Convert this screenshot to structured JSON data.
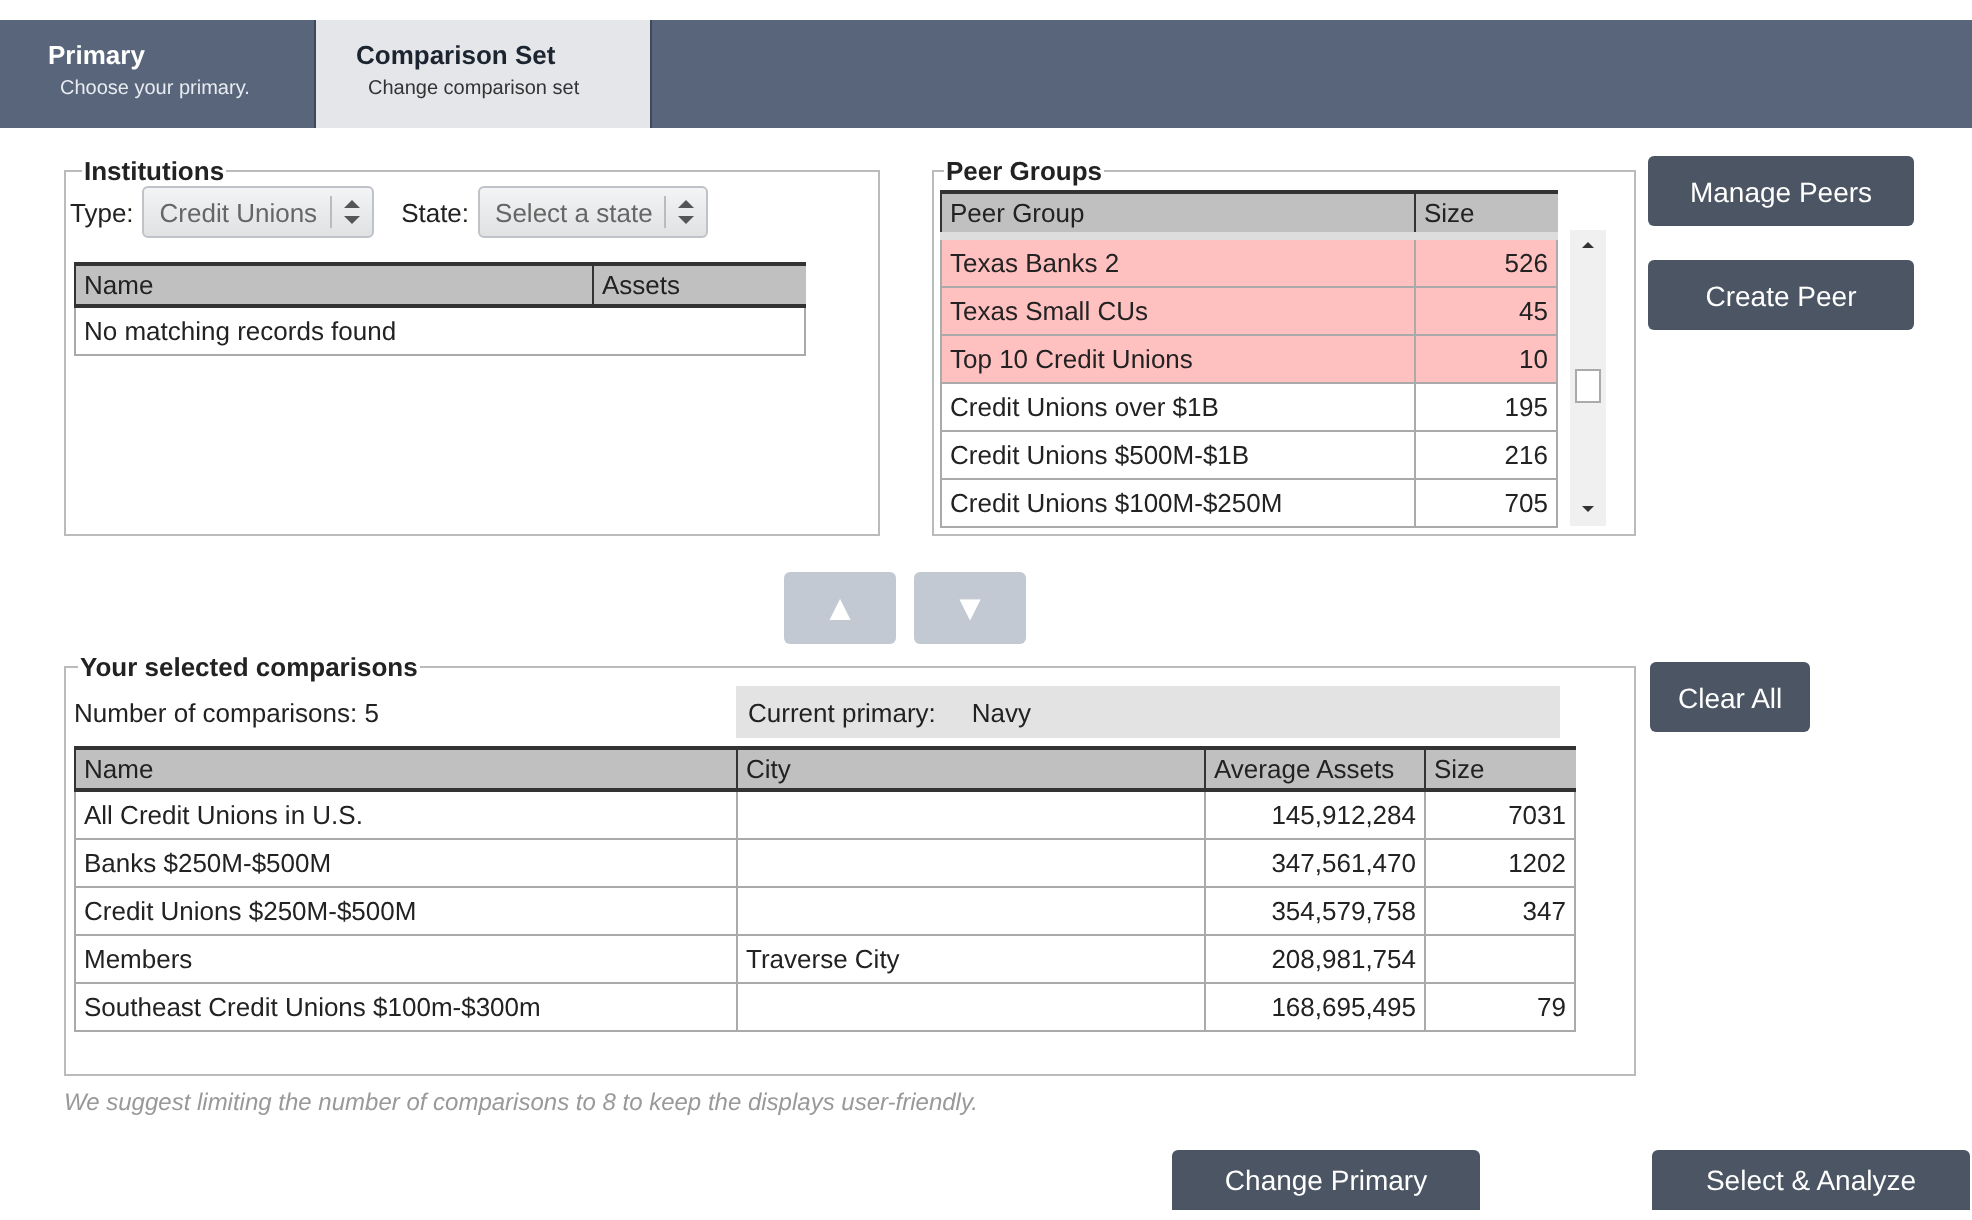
{
  "tabs": [
    {
      "label": "Primary",
      "subtitle": "Choose your primary.",
      "selected": false
    },
    {
      "label": "Comparison Set",
      "subtitle": "Change comparison set",
      "selected": true
    }
  ],
  "institutions": {
    "legend": "Institutions",
    "type_label": "Type:",
    "type_value": "Credit Unions",
    "state_label": "State:",
    "state_placeholder": "Select a state",
    "columns": [
      "Name",
      "Assets"
    ],
    "empty_message": "No matching records found"
  },
  "peer_groups": {
    "legend": "Peer Groups",
    "columns": [
      "Peer Group",
      "Size"
    ],
    "rows": [
      {
        "name": "Texas Banks 2",
        "size": "526",
        "selected": true
      },
      {
        "name": "Texas Small CUs",
        "size": "45",
        "selected": true
      },
      {
        "name": "Top 10 Credit Unions",
        "size": "10",
        "selected": true
      },
      {
        "name": "Credit Unions over $1B",
        "size": "195",
        "selected": false
      },
      {
        "name": "Credit Unions $500M-$1B",
        "size": "216",
        "selected": false
      },
      {
        "name": "Credit Unions $100M-$250M",
        "size": "705",
        "selected": false
      }
    ]
  },
  "peer_buttons": [
    "Manage Peers",
    "Create Peer"
  ],
  "move_buttons": [
    "▲",
    "▼"
  ],
  "comparisons": {
    "legend": "Your selected comparisons",
    "count_text": "Number of comparisons: 5",
    "primary_label": "Current primary:",
    "primary_value": "Navy",
    "columns": [
      "Name",
      "City",
      "Average Assets",
      "Size"
    ],
    "rows": [
      [
        "All Credit Unions in U.S.",
        "",
        "145,912,284",
        "7031"
      ],
      [
        "Banks $250M-$500M",
        "",
        "347,561,470",
        "1202"
      ],
      [
        "Credit Unions $250M-$500M",
        "",
        "354,579,758",
        "347"
      ],
      [
        "Members",
        "Traverse City",
        "208,981,754",
        ""
      ],
      [
        "Southeast Credit Unions $100m-$300m",
        "",
        "168,695,495",
        "79"
      ]
    ]
  },
  "clear_button": "Clear All",
  "hint": "We suggest limiting the number of comparisons to 8 to keep the displays user-friendly.",
  "footer_buttons": [
    "Change Primary",
    "Select & Analyze"
  ]
}
